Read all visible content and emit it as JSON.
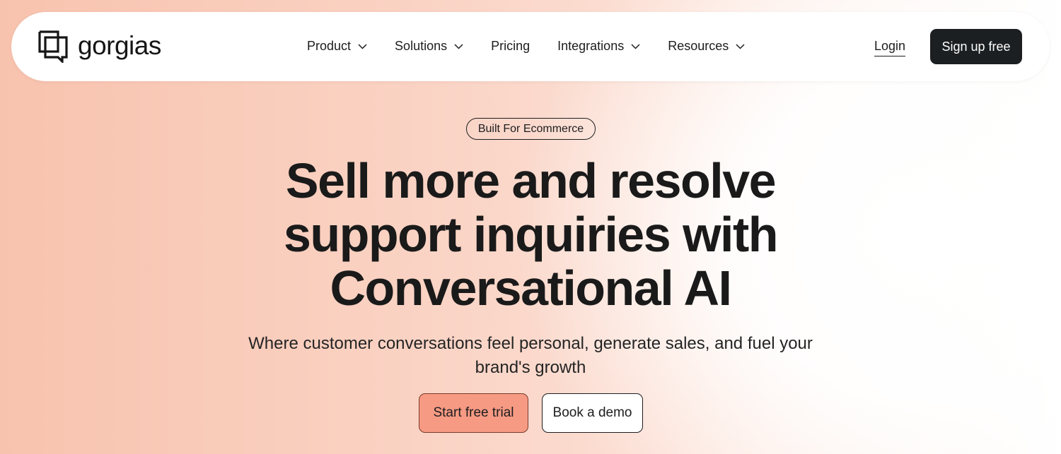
{
  "brand": {
    "name": "gorgias",
    "logo_icon": "gorgias-logo-icon"
  },
  "nav": {
    "items": [
      {
        "label": "Product",
        "has_dropdown": true
      },
      {
        "label": "Solutions",
        "has_dropdown": true
      },
      {
        "label": "Pricing",
        "has_dropdown": false
      },
      {
        "label": "Integrations",
        "has_dropdown": true
      },
      {
        "label": "Resources",
        "has_dropdown": true
      }
    ],
    "login_label": "Login",
    "signup_label": "Sign up free"
  },
  "hero": {
    "badge": "Built For Ecommerce",
    "headline_lines": [
      "Sell more and resolve",
      "support inquiries with",
      "Conversational AI"
    ],
    "subtitle": "Where customer conversations feel personal, generate sales, and fuel your brand's growth",
    "primary_cta": "Start free trial",
    "secondary_cta": "Book a demo"
  },
  "colors": {
    "accent": "#f79a83",
    "dark_button": "#1c1f22",
    "background_peach": "#f8c3ae"
  }
}
